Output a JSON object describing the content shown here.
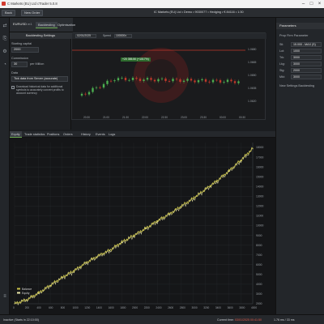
{
  "window": {
    "title": "C Markets (EU) Ltd cTrader 5.0.8"
  },
  "topbar": {
    "trade_btn": "Back",
    "new_order_btn": "New Order",
    "account_info": "IC Markets (EU) Ltd • Demo • 9030077 • Hedging • € 84116 • 1:30"
  },
  "symbol_bar": {
    "symbol": "EURUSD",
    "timeframe": "m1",
    "tabs": [
      "Backtesting",
      "Optimisation"
    ]
  },
  "backtest_settings": {
    "title": "Backtesting Settings",
    "starting_capital_label": "Starting capital",
    "starting_capital": "2000",
    "commission_label": "Commission",
    "commission": "30",
    "commission_unit": "per Million",
    "data_label": "Data",
    "data_value": "Tick data from Server (accurate)",
    "download_checkbox_label": "Download historical data for additional symbols to accurately convert profits to account currency"
  },
  "mini_chart": {
    "date": "02/01/2025",
    "speed_label": "Speed",
    "speed_value": "100000x",
    "badge": "+20 355.50 (+1017%)",
    "price_labels": [
      "1.0680",
      "1.0665",
      "1.0650",
      "1.0635",
      "1.0620"
    ],
    "time_labels": [
      "20:30",
      "21:00",
      "21:30",
      "22:00",
      "22:30",
      "23:00",
      "23:30",
      "00:00",
      "00:30"
    ]
  },
  "right_panel": {
    "title": "Parameters",
    "subtitle": "Prop Firm Parameter",
    "rows": [
      {
        "k": "Stl:",
        "v": "15.000 - MAX (S)"
      },
      {
        "k": "Lot:",
        "v": "1000"
      },
      {
        "k": "Trk:",
        "v": "3000"
      },
      {
        "k": "Lkg:",
        "v": "3000"
      },
      {
        "k": "Stg:",
        "v": "2000"
      },
      {
        "k": "Mkt:",
        "v": "3000"
      }
    ],
    "footer": "New Settings Backtesting"
  },
  "results_tabs": {
    "tabs": [
      "Equity",
      "Trade statistics",
      "Positions",
      "Orders",
      "History",
      "Events",
      "Logs"
    ],
    "active": "Equity"
  },
  "equity_chart": {
    "y_labels": [
      "18000",
      "17000",
      "16000",
      "15000",
      "14000",
      "13000",
      "12000",
      "11000",
      "10000",
      "9000",
      "8000",
      "7000",
      "6000",
      "5000",
      "4000",
      "3000",
      "2000"
    ],
    "x_labels": [
      "0",
      "200",
      "400",
      "600",
      "800",
      "1000",
      "1200",
      "1400",
      "1600",
      "1800",
      "2000",
      "2200",
      "2400",
      "2600",
      "2800",
      "3000",
      "3200",
      "3400",
      "3600",
      "3800",
      "4000"
    ],
    "legend": [
      "Balance",
      "Equity"
    ],
    "colors": {
      "balance": "#c9c24a",
      "equity": "#e9e6a8",
      "background": "#151618",
      "grid": "#2a2c30"
    }
  },
  "chart_data": {
    "type": "line",
    "x": [
      0,
      200,
      400,
      600,
      800,
      1000,
      1200,
      1400,
      1600,
      1800,
      2000,
      2200,
      2400,
      2600,
      2800,
      3000,
      3200,
      3400,
      3600,
      3800,
      4000
    ],
    "series": [
      {
        "name": "Balance",
        "values": [
          2000,
          2400,
          3100,
          3900,
          4700,
          5400,
          6200,
          6900,
          7500,
          8300,
          9000,
          9700,
          10500,
          11200,
          12000,
          12800,
          13700,
          14600,
          15600,
          16700,
          17900
        ]
      },
      {
        "name": "Equity",
        "values": [
          2000,
          2380,
          3050,
          3850,
          4650,
          5300,
          6150,
          6850,
          7400,
          8250,
          8900,
          9650,
          10400,
          11150,
          11900,
          12700,
          13650,
          14500,
          15550,
          16600,
          17850
        ]
      }
    ],
    "ylim": [
      2000,
      18500
    ],
    "xlim": [
      0,
      4000
    ]
  },
  "statusbar": {
    "left": "Inactive (Starts in 22:10:00)",
    "right_label": "Current time:",
    "right_value": "03/01/2025 00:41:50",
    "ping": "1.76 ms / 33 ms"
  }
}
